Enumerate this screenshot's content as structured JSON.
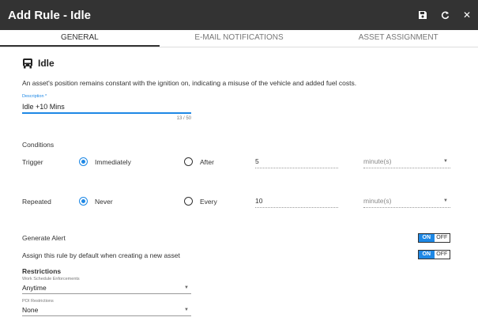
{
  "window": {
    "title": "Add Rule - Idle",
    "buttons": {
      "save_icon": "save-icon",
      "refresh_icon": "refresh-icon",
      "close_icon": "close-icon",
      "close_glyph": "✕"
    }
  },
  "tabs": [
    {
      "label": "GENERAL",
      "active": true
    },
    {
      "label": "E-MAIL NOTIFICATIONS",
      "active": false
    },
    {
      "label": "ASSET ASSIGNMENT",
      "active": false
    }
  ],
  "rule": {
    "icon": "bus-icon",
    "name": "Idle",
    "description_text": "An asset's position remains constant with the ignition on, indicating a misuse of the vehicle and added fuel costs."
  },
  "description_field": {
    "label": "Description *",
    "value": "Idle +10 Mins",
    "counter": "13 / 50"
  },
  "conditions": {
    "title": "Conditions",
    "trigger": {
      "label": "Trigger",
      "option1": "Immediately",
      "option2": "After",
      "selected": "Immediately",
      "amount": "5",
      "unit": "minute(s)"
    },
    "repeated": {
      "label": "Repeated",
      "option1": "Never",
      "option2": "Every",
      "selected": "Never",
      "amount": "10",
      "unit": "minute(s)"
    }
  },
  "toggles": {
    "on_label": "ON",
    "off_label": "OFF",
    "generate_alert": {
      "label": "Generate Alert",
      "state": "ON"
    },
    "assign_default": {
      "label": "Assign this rule by default when creating a new asset",
      "state": "ON"
    }
  },
  "restrictions": {
    "title": "Restrictions",
    "work_schedule": {
      "label": "Work Schedule Enforcements",
      "value": "Anytime"
    },
    "poi": {
      "label": "POI Restrictions",
      "value": "None"
    }
  },
  "colors": {
    "titlebar": "#333333",
    "accent": "#1e88e5"
  }
}
